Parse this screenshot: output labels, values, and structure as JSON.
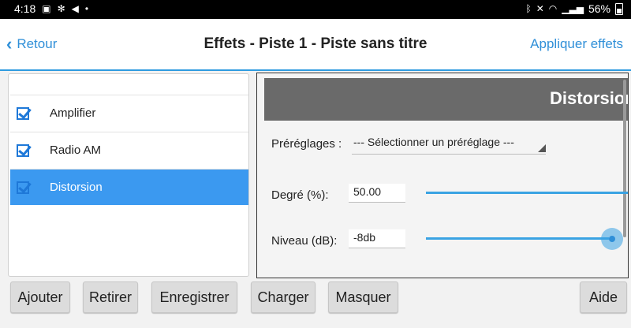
{
  "status_bar": {
    "time": "4:18",
    "battery": "56%"
  },
  "header": {
    "back_label": "Retour",
    "title": "Effets - Piste 1 - Piste sans titre",
    "apply_label": "Appliquer effets"
  },
  "effects": [
    {
      "label": "Amplifier",
      "checked": true,
      "selected": false
    },
    {
      "label": "Radio AM",
      "checked": true,
      "selected": false
    },
    {
      "label": "Distorsion",
      "checked": true,
      "selected": true
    }
  ],
  "panel": {
    "title": "Distorsion",
    "presets_label": "Préréglages :",
    "preset_value": "--- Sélectionner un préréglage ---",
    "degree_label": "Degré (%):",
    "degree_value": "50.00",
    "level_label": "Niveau (dB):",
    "level_value": "-8db"
  },
  "buttons": {
    "add": "Ajouter",
    "remove": "Retirer",
    "save": "Enregistrer",
    "load": "Charger",
    "hide": "Masquer",
    "help": "Aide"
  },
  "colors": {
    "accent": "#2f8fd8",
    "selected_row": "#3b99f0",
    "panel_header": "#6a6a6a"
  }
}
